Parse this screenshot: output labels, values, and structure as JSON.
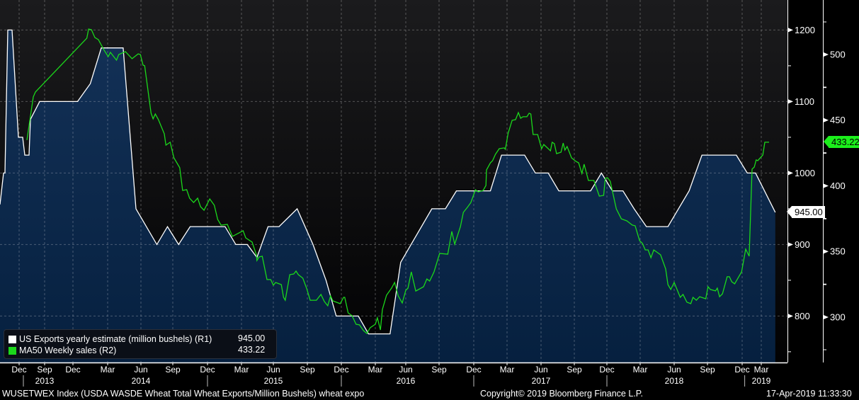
{
  "chart_data": {
    "type": "line",
    "title": "",
    "footer_left": "WUSETWEX Index (USDA WASDE Wheat Total Wheat Exports/Million Bushels) wheat expo",
    "footer_center": "Copyright© 2019 Bloomberg Finance L.P.",
    "footer_right": "17-Apr-2019 11:33:30",
    "x_ticks": [
      {
        "label": "Dec",
        "m": 11
      },
      {
        "label": "Sep",
        "m": 20
      },
      {
        "label": "Dec",
        "m": 23
      },
      {
        "label": "Mar",
        "m": 26
      },
      {
        "label": "Jun",
        "m": 29
      },
      {
        "label": "Sep",
        "m": 32
      },
      {
        "label": "Dec",
        "m": 35
      },
      {
        "label": "Mar",
        "m": 38
      },
      {
        "label": "Jun",
        "m": 41
      },
      {
        "label": "Sep",
        "m": 44
      },
      {
        "label": "Dec",
        "m": 47
      },
      {
        "label": "Mar",
        "m": 50
      },
      {
        "label": "Jun",
        "m": 53
      },
      {
        "label": "Sep",
        "m": 56
      },
      {
        "label": "Dec",
        "m": 59
      },
      {
        "label": "Mar",
        "m": 62
      },
      {
        "label": "Jun",
        "m": 65
      },
      {
        "label": "Sep",
        "m": 68
      },
      {
        "label": "Dec",
        "m": 71
      },
      {
        "label": "Mar",
        "m": 74
      },
      {
        "label": "Jun",
        "m": 77
      },
      {
        "label": "Sep",
        "m": 80
      },
      {
        "label": "Dec",
        "m": 83
      },
      {
        "label": "Mar",
        "m": 86
      }
    ],
    "year_labels": [
      {
        "label": "2013",
        "m": 20
      },
      {
        "label": "2014",
        "m": 29
      },
      {
        "label": "2015",
        "m": 41
      },
      {
        "label": "2016",
        "m": 53
      },
      {
        "label": "2017",
        "m": 65
      },
      {
        "label": "2018",
        "m": 77
      },
      {
        "label": "2019",
        "m": 86
      }
    ],
    "year_separators_m": [
      12.5,
      35,
      47,
      59,
      71,
      83.4
    ],
    "y_left": {
      "ticks": [
        800,
        900,
        1000,
        1100,
        1200
      ],
      "ylim": [
        735,
        1242
      ]
    },
    "y_right": {
      "ticks": [
        300,
        350,
        400,
        450,
        500
      ],
      "ylim": [
        265.5,
        541.5
      ]
    },
    "legend_position": "bottom-left",
    "grid": true,
    "series": [
      {
        "name": "US Exports yearly estimate (million bushels) (R1)",
        "last_value": "945.00",
        "axis": "left",
        "color": "#ffffff",
        "fill": true,
        "points": [
          [
            4.25,
            956
          ],
          [
            5.5,
            1000
          ],
          [
            6.0,
            1000
          ],
          [
            7.0,
            1200
          ],
          [
            8.5,
            1200
          ],
          [
            10.75,
            1050
          ],
          [
            12.25,
            1050
          ],
          [
            13.0,
            1025
          ],
          [
            14.5,
            1025
          ],
          [
            15.0,
            1075
          ],
          [
            18.25,
            1100
          ],
          [
            23.4,
            1100
          ],
          [
            24.5,
            1125
          ],
          [
            25.45,
            1175
          ],
          [
            27.4,
            1175
          ],
          [
            28.55,
            950
          ],
          [
            30.5,
            900
          ],
          [
            31.5,
            925
          ],
          [
            32.5,
            900
          ],
          [
            33.5,
            925
          ],
          [
            36.55,
            925
          ],
          [
            37.5,
            900
          ],
          [
            38.55,
            900
          ],
          [
            39.45,
            882
          ],
          [
            40.5,
            925
          ],
          [
            41.5,
            925
          ],
          [
            43.1,
            950
          ],
          [
            44.5,
            900
          ],
          [
            45.65,
            850
          ],
          [
            46.55,
            800
          ],
          [
            48.5,
            800
          ],
          [
            49.4,
            775
          ],
          [
            51.45,
            775
          ],
          [
            52.5,
            875
          ],
          [
            55.35,
            950
          ],
          [
            56.55,
            950
          ],
          [
            57.5,
            975
          ],
          [
            60.5,
            975
          ],
          [
            61.5,
            1025
          ],
          [
            63.55,
            1025
          ],
          [
            64.5,
            1000
          ],
          [
            65.65,
            1000
          ],
          [
            66.6,
            975
          ],
          [
            69.5,
            975
          ],
          [
            70.5,
            1000
          ],
          [
            71.5,
            975
          ],
          [
            72.45,
            975
          ],
          [
            73.45,
            950
          ],
          [
            74.55,
            925
          ],
          [
            76.45,
            925
          ],
          [
            78.35,
            975
          ],
          [
            79.5,
            1025
          ],
          [
            82.5,
            1025
          ],
          [
            83.8,
            1000
          ],
          [
            85.1,
            1000
          ],
          [
            87.8,
            945
          ]
        ]
      },
      {
        "name": "MA50 Weekly sales (R2)",
        "last_value": "433.22",
        "axis": "right",
        "color": "#1bd81b",
        "fill": false,
        "points": [
          [
            13.75,
            434.8
          ],
          [
            16.0,
            467.7
          ],
          [
            16.75,
            471.4
          ],
          [
            24.2,
            512.4
          ],
          [
            24.35,
            519.4
          ],
          [
            24.6,
            518.9
          ],
          [
            24.9,
            512.9
          ],
          [
            25.2,
            511.3
          ],
          [
            25.7,
            503.2
          ],
          [
            26.05,
            498.4
          ],
          [
            26.25,
            501.6
          ],
          [
            26.8,
            495.7
          ],
          [
            27.0,
            500
          ],
          [
            27.6,
            502.2
          ],
          [
            28.2,
            496.8
          ],
          [
            28.75,
            500.5
          ],
          [
            28.95,
            500
          ],
          [
            29.2,
            491.9
          ],
          [
            29.35,
            491.4
          ],
          [
            29.95,
            455.3
          ],
          [
            30.15,
            451
          ],
          [
            30.35,
            454.7
          ],
          [
            30.65,
            450.4
          ],
          [
            31.2,
            439.6
          ],
          [
            31.35,
            431
          ],
          [
            31.75,
            433.2
          ],
          [
            32.1,
            421.3
          ],
          [
            32.6,
            413.8
          ],
          [
            32.85,
            396.5
          ],
          [
            33.2,
            397.1
          ],
          [
            33.45,
            390.6
          ],
          [
            33.8,
            387.3
          ],
          [
            34.15,
            390.6
          ],
          [
            34.4,
            384.1
          ],
          [
            34.7,
            381.4
          ],
          [
            35.2,
            390
          ],
          [
            35.6,
            385.2
          ],
          [
            35.9,
            374.4
          ],
          [
            36.2,
            370.1
          ],
          [
            36.75,
            370.6
          ],
          [
            37.2,
            361.5
          ],
          [
            38.15,
            365.8
          ],
          [
            38.4,
            360.4
          ],
          [
            39.0,
            357.2
          ],
          [
            39.4,
            347.5
          ],
          [
            39.45,
            343.1
          ],
          [
            39.65,
            345.8
          ],
          [
            39.95,
            346.4
          ],
          [
            40.4,
            328.6
          ],
          [
            40.75,
            328.6
          ],
          [
            41.0,
            324.3
          ],
          [
            41.2,
            326.4
          ],
          [
            41.7,
            324.8
          ],
          [
            41.9,
            315.1
          ],
          [
            42.05,
            312.9
          ],
          [
            42.45,
            332.4
          ],
          [
            42.8,
            332.9
          ],
          [
            43.0,
            335.1
          ],
          [
            43.2,
            332.4
          ],
          [
            43.6,
            329.7
          ],
          [
            43.95,
            321.6
          ],
          [
            44.25,
            312.9
          ],
          [
            44.8,
            312.9
          ],
          [
            45.2,
            317.3
          ],
          [
            45.5,
            311.9
          ],
          [
            45.8,
            308.7
          ],
          [
            46.05,
            316.2
          ],
          [
            46.25,
            312.4
          ],
          [
            46.9,
            310.3
          ],
          [
            47.2,
            315.1
          ],
          [
            47.3,
            315.1
          ],
          [
            47.6,
            303.3
          ],
          [
            47.95,
            301.1
          ],
          [
            48.3,
            294.6
          ],
          [
            48.6,
            294.1
          ],
          [
            48.95,
            289.8
          ],
          [
            49.25,
            287.6
          ],
          [
            49.55,
            292
          ],
          [
            50.0,
            294.6
          ],
          [
            50.2,
            299.5
          ],
          [
            50.5,
            290.3
          ],
          [
            50.7,
            305.9
          ],
          [
            51.1,
            316.7
          ],
          [
            51.6,
            322.1
          ],
          [
            51.9,
            326.4
          ],
          [
            52.25,
            316.2
          ],
          [
            52.65,
            310.8
          ],
          [
            53.0,
            320.5
          ],
          [
            53.2,
            322.1
          ],
          [
            53.5,
            334.5
          ],
          [
            53.9,
            319.9
          ],
          [
            54.6,
            323.2
          ],
          [
            54.9,
            329.1
          ],
          [
            55.15,
            327.5
          ],
          [
            55.55,
            334.5
          ],
          [
            56.05,
            348.5
          ],
          [
            56.75,
            348
          ],
          [
            57.1,
            365.3
          ],
          [
            57.35,
            355.6
          ],
          [
            57.85,
            369
          ],
          [
            58.1,
            379.8
          ],
          [
            58.45,
            383.6
          ],
          [
            58.75,
            387.3
          ],
          [
            59.15,
            397
          ],
          [
            59.4,
            395.4
          ],
          [
            59.85,
            396.5
          ],
          [
            60.1,
            400.3
          ],
          [
            60.15,
            412.1
          ],
          [
            60.5,
            417.5
          ],
          [
            60.7,
            419.2
          ],
          [
            60.95,
            424
          ],
          [
            61.3,
            428.3
          ],
          [
            61.75,
            428.9
          ],
          [
            61.85,
            427.8
          ],
          [
            62.1,
            440.2
          ],
          [
            62.45,
            449.9
          ],
          [
            62.75,
            450.4
          ],
          [
            63.0,
            455.8
          ],
          [
            63.2,
            451.5
          ],
          [
            63.4,
            452.6
          ],
          [
            63.75,
            452.6
          ],
          [
            63.95,
            455.3
          ],
          [
            64.1,
            454.7
          ],
          [
            64.3,
            439.1
          ],
          [
            64.7,
            439.1
          ],
          [
            65.05,
            428.3
          ],
          [
            65.25,
            431.5
          ],
          [
            65.85,
            426.7
          ],
          [
            66.0,
            433.2
          ],
          [
            66.2,
            432.1
          ],
          [
            66.4,
            424.5
          ],
          [
            66.8,
            425.6
          ],
          [
            67.0,
            432.6
          ],
          [
            67.15,
            427.2
          ],
          [
            67.35,
            429.9
          ],
          [
            67.75,
            421.3
          ],
          [
            68.15,
            418.6
          ],
          [
            68.4,
            417.5
          ],
          [
            68.7,
            409.4
          ],
          [
            68.9,
            416.5
          ],
          [
            69.3,
            404.1
          ],
          [
            69.8,
            404.1
          ],
          [
            70.3,
            392.2
          ],
          [
            70.7,
            392.7
          ],
          [
            70.85,
            405.7
          ],
          [
            71.05,
            406.2
          ],
          [
            71.3,
            403.5
          ],
          [
            71.85,
            382.5
          ],
          [
            72.3,
            374.9
          ],
          [
            72.8,
            373.3
          ],
          [
            73.3,
            370.1
          ],
          [
            73.55,
            369.6
          ],
          [
            73.95,
            358.2
          ],
          [
            74.2,
            356.1
          ],
          [
            74.45,
            351.2
          ],
          [
            74.7,
            351.2
          ],
          [
            74.95,
            345.3
          ],
          [
            75.2,
            351.2
          ],
          [
            75.8,
            347.5
          ],
          [
            76.25,
            336.7
          ],
          [
            76.45,
            324.8
          ],
          [
            76.7,
            321.1
          ],
          [
            77.0,
            326.4
          ],
          [
            77.55,
            315.1
          ],
          [
            77.8,
            317.3
          ],
          [
            78.15,
            311.4
          ],
          [
            78.5,
            310.3
          ],
          [
            78.7,
            315.1
          ],
          [
            79.0,
            312.9
          ],
          [
            79.3,
            315.6
          ],
          [
            79.85,
            314
          ],
          [
            80.05,
            323.2
          ],
          [
            80.25,
            321.1
          ],
          [
            80.7,
            320
          ],
          [
            80.85,
            322.1
          ],
          [
            81.05,
            315.6
          ],
          [
            81.3,
            317.8
          ],
          [
            81.7,
            330.8
          ],
          [
            81.9,
            330.8
          ],
          [
            82.1,
            327
          ],
          [
            82.35,
            325.4
          ],
          [
            82.95,
            334.5
          ],
          [
            83.55,
            351.8
          ],
          [
            84.1,
            346.4
          ],
          [
            84.55,
            412.7
          ],
          [
            84.9,
            414.3
          ],
          [
            85.2,
            419.7
          ],
          [
            85.45,
            419.2
          ],
          [
            86.2,
            423.5
          ],
          [
            86.45,
            433.22
          ],
          [
            87.0,
            433.22
          ]
        ]
      }
    ]
  }
}
